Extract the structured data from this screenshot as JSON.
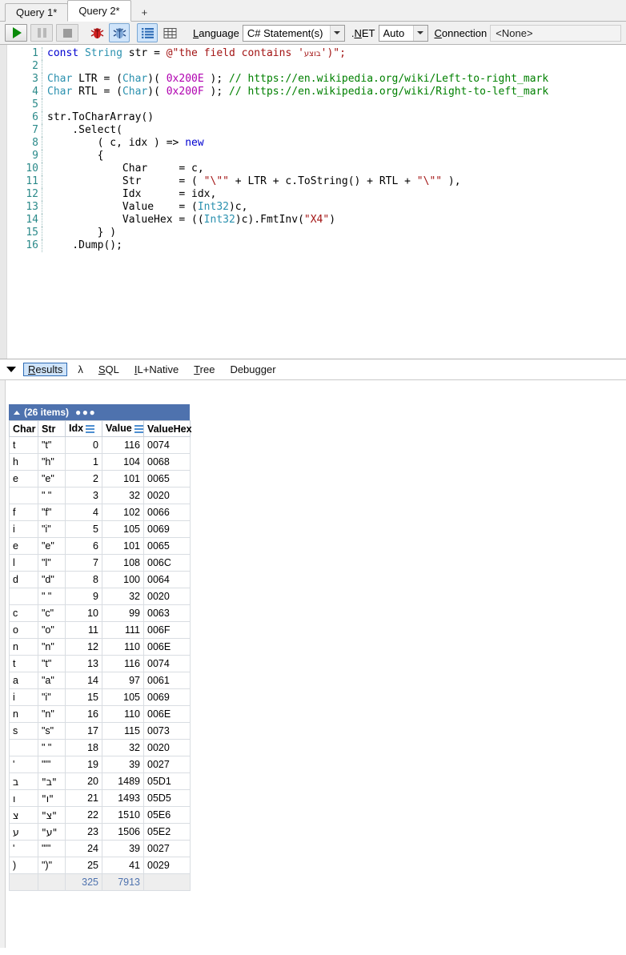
{
  "tabs": {
    "items": [
      {
        "label": "Query 1*",
        "active": false
      },
      {
        "label": "Query 2*",
        "active": true
      }
    ],
    "new_tab_label": "+"
  },
  "toolbar": {
    "run_icon": "play-icon",
    "pause_icon": "pause-icon",
    "stop_icon": "stop-icon",
    "debug_icon": "red-bug-icon",
    "debug_alt_icon": "blue-bug-icon",
    "results_grid_icon": "list-view-icon",
    "table_grid_icon": "table-view-icon",
    "language_label": "Language",
    "language_label_accel": "L",
    "language_value": "C# Statement(s)",
    "net_label": ".NET",
    "net_label_accel": "N",
    "net_value": "Auto",
    "connection_label": "Connection",
    "connection_label_accel": "C",
    "connection_value": "<None>"
  },
  "editor": {
    "lines": [
      {
        "n": "1",
        "tokens": [
          {
            "t": "const ",
            "c": "k"
          },
          {
            "t": "String ",
            "c": "t"
          },
          {
            "t": "str = ",
            "c": "p"
          },
          {
            "t": "@\"the field contains '",
            "c": "s"
          },
          {
            "t": "בוצע",
            "c": "s heb"
          },
          {
            "t": "')\";",
            "c": "s"
          }
        ]
      },
      {
        "n": "2",
        "tokens": []
      },
      {
        "n": "3",
        "tokens": [
          {
            "t": "Char ",
            "c": "t"
          },
          {
            "t": "LTR = (",
            "c": "p"
          },
          {
            "t": "Char",
            "c": "t"
          },
          {
            "t": ")( ",
            "c": "p"
          },
          {
            "t": "0x200E",
            "c": "n"
          },
          {
            "t": " ); ",
            "c": "p"
          },
          {
            "t": "// https://en.wikipedia.org/wiki/Left-to-right_mark",
            "c": "c"
          }
        ]
      },
      {
        "n": "4",
        "tokens": [
          {
            "t": "Char ",
            "c": "t"
          },
          {
            "t": "RTL = (",
            "c": "p"
          },
          {
            "t": "Char",
            "c": "t"
          },
          {
            "t": ")( ",
            "c": "p"
          },
          {
            "t": "0x200F",
            "c": "n"
          },
          {
            "t": " ); ",
            "c": "p"
          },
          {
            "t": "// https://en.wikipedia.org/wiki/Right-to-left_mark",
            "c": "c"
          }
        ]
      },
      {
        "n": "5",
        "tokens": []
      },
      {
        "n": "6",
        "tokens": [
          {
            "t": "str.ToCharArray()",
            "c": "p"
          }
        ]
      },
      {
        "n": "7",
        "tokens": [
          {
            "t": "    .Select(",
            "c": "p"
          }
        ]
      },
      {
        "n": "8",
        "tokens": [
          {
            "t": "        ( c, idx ) => ",
            "c": "p"
          },
          {
            "t": "new",
            "c": "k"
          }
        ]
      },
      {
        "n": "9",
        "tokens": [
          {
            "t": "        {",
            "c": "p"
          }
        ]
      },
      {
        "n": "10",
        "tokens": [
          {
            "t": "            Char     = c,",
            "c": "p"
          }
        ]
      },
      {
        "n": "11",
        "tokens": [
          {
            "t": "            Str      = ( ",
            "c": "p"
          },
          {
            "t": "\"\\\"\"",
            "c": "s"
          },
          {
            "t": " + LTR + c.ToString() + RTL + ",
            "c": "p"
          },
          {
            "t": "\"\\\"\"",
            "c": "s"
          },
          {
            "t": " ),",
            "c": "p"
          }
        ]
      },
      {
        "n": "12",
        "tokens": [
          {
            "t": "            Idx      = idx,",
            "c": "p"
          }
        ]
      },
      {
        "n": "13",
        "tokens": [
          {
            "t": "            Value    = (",
            "c": "p"
          },
          {
            "t": "Int32",
            "c": "t"
          },
          {
            "t": ")c,",
            "c": "p"
          }
        ]
      },
      {
        "n": "14",
        "tokens": [
          {
            "t": "            ValueHex = ((",
            "c": "p"
          },
          {
            "t": "Int32",
            "c": "t"
          },
          {
            "t": ")c).FmtInv(",
            "c": "p"
          },
          {
            "t": "\"X4\"",
            "c": "s"
          },
          {
            "t": ")",
            "c": "p"
          }
        ]
      },
      {
        "n": "15",
        "tokens": [
          {
            "t": "        } )",
            "c": "p"
          }
        ]
      },
      {
        "n": "16",
        "tokens": [
          {
            "t": "    .Dump();",
            "c": "p"
          }
        ]
      }
    ]
  },
  "results_bar": {
    "collapse_icon": "collapse-triangle-icon",
    "tabs": [
      {
        "label": "Results",
        "accel": "R",
        "active": true
      },
      {
        "label": "λ",
        "accel": "",
        "active": false
      },
      {
        "label": "SQL",
        "accel": "S",
        "active": false
      },
      {
        "label": "IL+Native",
        "accel": "I",
        "active": false
      },
      {
        "label": "Tree",
        "accel": "T",
        "active": false
      },
      {
        "label": "Debugger",
        "accel": "g",
        "active": false
      }
    ]
  },
  "grid": {
    "caption": "(26 items)",
    "more_icon": "ellipsis-icon",
    "columns": [
      {
        "name": "Char",
        "align": "left",
        "menu": false
      },
      {
        "name": "Str",
        "align": "left",
        "menu": false
      },
      {
        "name": "Idx",
        "align": "right",
        "menu": true
      },
      {
        "name": "Value",
        "align": "right",
        "menu": true
      },
      {
        "name": "ValueHex",
        "align": "left",
        "menu": false
      }
    ],
    "rows": [
      {
        "char": "t",
        "str": "\"t\"",
        "idx": "0",
        "value": "116",
        "hex": "0074"
      },
      {
        "char": "h",
        "str": "\"h\"",
        "idx": "1",
        "value": "104",
        "hex": "0068"
      },
      {
        "char": "e",
        "str": "\"e\"",
        "idx": "2",
        "value": "101",
        "hex": "0065"
      },
      {
        "char": " ",
        "str": "\" \"",
        "idx": "3",
        "value": "32",
        "hex": "0020"
      },
      {
        "char": "f",
        "str": "\"f\"",
        "idx": "4",
        "value": "102",
        "hex": "0066"
      },
      {
        "char": "i",
        "str": "\"i\"",
        "idx": "5",
        "value": "105",
        "hex": "0069"
      },
      {
        "char": "e",
        "str": "\"e\"",
        "idx": "6",
        "value": "101",
        "hex": "0065"
      },
      {
        "char": "l",
        "str": "\"l\"",
        "idx": "7",
        "value": "108",
        "hex": "006C"
      },
      {
        "char": "d",
        "str": "\"d\"",
        "idx": "8",
        "value": "100",
        "hex": "0064"
      },
      {
        "char": " ",
        "str": "\" \"",
        "idx": "9",
        "value": "32",
        "hex": "0020"
      },
      {
        "char": "c",
        "str": "\"c\"",
        "idx": "10",
        "value": "99",
        "hex": "0063"
      },
      {
        "char": "o",
        "str": "\"o\"",
        "idx": "11",
        "value": "111",
        "hex": "006F"
      },
      {
        "char": "n",
        "str": "\"n\"",
        "idx": "12",
        "value": "110",
        "hex": "006E"
      },
      {
        "char": "t",
        "str": "\"t\"",
        "idx": "13",
        "value": "116",
        "hex": "0074"
      },
      {
        "char": "a",
        "str": "\"a\"",
        "idx": "14",
        "value": "97",
        "hex": "0061"
      },
      {
        "char": "i",
        "str": "\"i\"",
        "idx": "15",
        "value": "105",
        "hex": "0069"
      },
      {
        "char": "n",
        "str": "\"n\"",
        "idx": "16",
        "value": "110",
        "hex": "006E"
      },
      {
        "char": "s",
        "str": "\"s\"",
        "idx": "17",
        "value": "115",
        "hex": "0073"
      },
      {
        "char": " ",
        "str": "\" \"",
        "idx": "18",
        "value": "32",
        "hex": "0020"
      },
      {
        "char": "'",
        "str": "\"'\"",
        "idx": "19",
        "value": "39",
        "hex": "0027"
      },
      {
        "char": "ב",
        "str": "\"ב\"",
        "idx": "20",
        "value": "1489",
        "hex": "05D1",
        "rtl": true
      },
      {
        "char": "ו",
        "str": "\"ו\"",
        "idx": "21",
        "value": "1493",
        "hex": "05D5",
        "rtl": true
      },
      {
        "char": "צ",
        "str": "\"צ\"",
        "idx": "22",
        "value": "1510",
        "hex": "05E6",
        "rtl": true
      },
      {
        "char": "ע",
        "str": "\"ע\"",
        "idx": "23",
        "value": "1506",
        "hex": "05E2",
        "rtl": true
      },
      {
        "char": "'",
        "str": "\"'\"",
        "idx": "24",
        "value": "39",
        "hex": "0027"
      },
      {
        "char": ")",
        "str": "\")\"",
        "idx": "25",
        "value": "41",
        "hex": "0029"
      }
    ],
    "totals": {
      "char": "",
      "str": "",
      "idx": "325",
      "value": "7913",
      "hex": ""
    }
  },
  "colors": {
    "accent_blue": "#4e72ae",
    "selection_blue": "#cfe4fa",
    "keyword": "#0000d0",
    "type": "#2b91af",
    "string": "#a31515",
    "comment": "#008000",
    "number": "#b000b0",
    "linenum": "#2b8a8a"
  }
}
